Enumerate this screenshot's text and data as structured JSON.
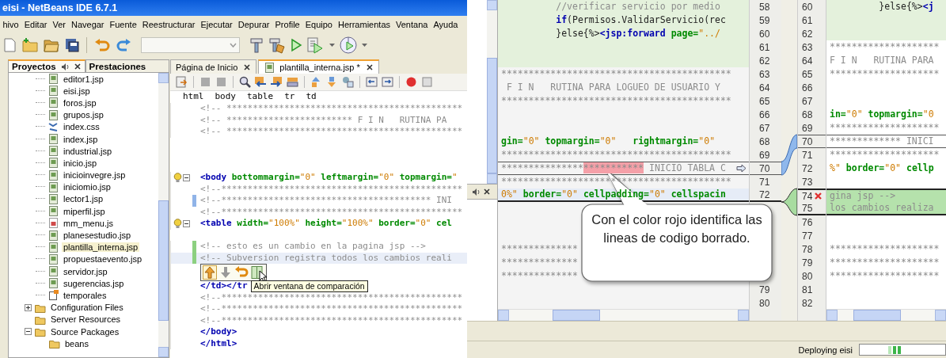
{
  "window": {
    "title": "eisi - NetBeans IDE 6.7.1"
  },
  "menu": [
    "hivo",
    "Editar",
    "Ver",
    "Navegar",
    "Fuente",
    "Reestructurar",
    "Ejecutar",
    "Depurar",
    "Profile",
    "Equipo",
    "Herramientas",
    "Ventana",
    "Ayuda"
  ],
  "panel": {
    "tabs": [
      {
        "label": "Proyectos",
        "selected": true
      },
      {
        "label": "Prestaciones",
        "selected": false
      }
    ],
    "tree": {
      "files": [
        {
          "label": "editor1.jsp",
          "kind": "jsp",
          "selected": false
        },
        {
          "label": "eisi.jsp",
          "kind": "jsp",
          "selected": false
        },
        {
          "label": "foros.jsp",
          "kind": "jsp",
          "selected": false
        },
        {
          "label": "grupos.jsp",
          "kind": "jsp",
          "selected": false
        },
        {
          "label": "index.css",
          "kind": "css",
          "selected": false
        },
        {
          "label": "index.jsp",
          "kind": "jsp",
          "selected": false
        },
        {
          "label": "industrial.jsp",
          "kind": "jsp",
          "selected": false
        },
        {
          "label": "inicio.jsp",
          "kind": "jsp",
          "selected": false
        },
        {
          "label": "inicioinvegre.jsp",
          "kind": "jsp",
          "selected": false
        },
        {
          "label": "iniciomio.jsp",
          "kind": "jsp",
          "selected": false
        },
        {
          "label": "lector1.jsp",
          "kind": "jsp",
          "selected": false
        },
        {
          "label": "miperfil.jsp",
          "kind": "jsp",
          "selected": false
        },
        {
          "label": "mm_menu.js",
          "kind": "js",
          "selected": false
        },
        {
          "label": "planesestudio.jsp",
          "kind": "jsp",
          "selected": false
        },
        {
          "label": "plantilla_interna.jsp",
          "kind": "jsp",
          "selected": true
        },
        {
          "label": "propuestaevento.jsp",
          "kind": "jsp",
          "selected": false
        },
        {
          "label": "servidor.jsp",
          "kind": "jsp",
          "selected": false
        },
        {
          "label": "sugerencias.jsp",
          "kind": "jsp",
          "selected": false
        },
        {
          "label": "temporales",
          "kind": "marked",
          "selected": false
        }
      ],
      "groups": [
        {
          "label": "Configuration Files",
          "expanded": false
        },
        {
          "label": "Server Resources"
        },
        {
          "label": "Source Packages",
          "expanded": true,
          "children": [
            {
              "label": "beans"
            }
          ]
        }
      ]
    }
  },
  "editor": {
    "tabs": [
      {
        "label": "Página de Inicio",
        "selected": false
      },
      {
        "label": "plantilla_interna.jsp *",
        "selected": true
      }
    ],
    "breadcrumb": [
      "html",
      "body",
      "table",
      "tr",
      "td"
    ],
    "lines": [
      {
        "kind": "code",
        "hint": false,
        "fold": false,
        "added_marker": false,
        "changed_marker": false,
        "current": false,
        "segs": [
          {
            "kind": "comment",
            "text": "<!-- *********************************************"
          }
        ]
      },
      {
        "kind": "code",
        "hint": false,
        "fold": false,
        "added_marker": false,
        "changed_marker": false,
        "current": false,
        "segs": [
          {
            "kind": "comment",
            "text": "<!-- ************************ F I N   RUTINA PA"
          }
        ]
      },
      {
        "kind": "code",
        "hint": false,
        "fold": false,
        "added_marker": false,
        "changed_marker": false,
        "current": false,
        "segs": [
          {
            "kind": "comment",
            "text": "<!-- *********************************************"
          }
        ]
      },
      {
        "kind": "blank"
      },
      {
        "kind": "blank"
      },
      {
        "kind": "blank"
      },
      {
        "kind": "code",
        "hint": true,
        "fold": true,
        "added_marker": false,
        "changed_marker": false,
        "current": false,
        "segs": [
          {
            "kind": "tag",
            "text": "<body"
          },
          {
            "kind": "attr",
            "text": " bottommargin="
          },
          {
            "kind": "value",
            "text": "\"0\""
          },
          {
            "kind": "attr",
            "text": " leftmargin="
          },
          {
            "kind": "value",
            "text": "\"0\""
          },
          {
            "kind": "attr",
            "text": " topmargin="
          },
          {
            "kind": "value",
            "text": "\""
          }
        ]
      },
      {
        "kind": "code",
        "hint": false,
        "fold": false,
        "added_marker": false,
        "changed_marker": false,
        "current": false,
        "segs": [
          {
            "kind": "comment",
            "text": "<!--**********************************************"
          }
        ]
      },
      {
        "kind": "code",
        "hint": false,
        "fold": false,
        "added_marker": false,
        "changed_marker": true,
        "current": false,
        "segs": [
          {
            "kind": "comment",
            "text": "<!--**************************************** INI"
          }
        ]
      },
      {
        "kind": "code",
        "hint": false,
        "fold": false,
        "added_marker": false,
        "changed_marker": false,
        "current": false,
        "segs": [
          {
            "kind": "comment",
            "text": "<!--**********************************************"
          }
        ]
      },
      {
        "kind": "code",
        "hint": true,
        "fold": true,
        "added_marker": false,
        "changed_marker": false,
        "current": false,
        "segs": [
          {
            "kind": "tag",
            "text": "<table"
          },
          {
            "kind": "attr",
            "text": " width="
          },
          {
            "kind": "value",
            "text": "\"100%\""
          },
          {
            "kind": "attr",
            "text": " height="
          },
          {
            "kind": "value",
            "text": "\"100%\""
          },
          {
            "kind": "attr",
            "text": " border="
          },
          {
            "kind": "value",
            "text": "\"0\""
          },
          {
            "kind": "attr",
            "text": " cel"
          }
        ]
      },
      {
        "kind": "blank"
      },
      {
        "kind": "code",
        "hint": false,
        "fold": false,
        "added_marker": true,
        "changed_marker": false,
        "current": false,
        "segs": [
          {
            "kind": "comment",
            "text": "<!-- esto es un cambio en la pagina jsp -->"
          }
        ]
      },
      {
        "kind": "code",
        "hint": false,
        "fold": false,
        "added_marker": true,
        "changed_marker": false,
        "current": true,
        "segs": [
          {
            "kind": "comment",
            "text": "<!-- Subversion registra todos los cambios reali"
          }
        ]
      },
      {
        "kind": "popup"
      },
      {
        "kind": "code",
        "hint": false,
        "fold": false,
        "added_marker": false,
        "changed_marker": false,
        "current": false,
        "segs": [
          {
            "kind": "tag",
            "text": "</td></tr"
          }
        ],
        "tooltip": "Abrir ventana de comparación"
      },
      {
        "kind": "code",
        "hint": false,
        "fold": false,
        "added_marker": false,
        "changed_marker": false,
        "current": false,
        "segs": [
          {
            "kind": "comment",
            "text": "<!--**********************************************"
          }
        ]
      },
      {
        "kind": "code",
        "hint": false,
        "fold": false,
        "added_marker": false,
        "changed_marker": false,
        "current": false,
        "segs": [
          {
            "kind": "comment",
            "text": "<!--**********************************************"
          }
        ]
      },
      {
        "kind": "code",
        "hint": false,
        "fold": false,
        "added_marker": false,
        "changed_marker": false,
        "current": false,
        "segs": [
          {
            "kind": "comment",
            "text": "<!--**********************************************"
          }
        ]
      },
      {
        "kind": "code",
        "hint": false,
        "fold": false,
        "added_marker": false,
        "changed_marker": false,
        "current": false,
        "segs": [
          {
            "kind": "tag",
            "text": "</body>"
          }
        ]
      },
      {
        "kind": "code",
        "hint": false,
        "fold": false,
        "added_marker": false,
        "changed_marker": false,
        "current": false,
        "segs": [
          {
            "kind": "tag",
            "text": "</html>"
          }
        ]
      }
    ]
  },
  "diff": {
    "left": [
      {
        "num": "58",
        "kind": "added",
        "segs": [
          {
            "kind": "comment",
            "text": "          //verificar servicio por medio"
          }
        ]
      },
      {
        "num": "59",
        "kind": "added",
        "segs": [
          {
            "kind": "keyword",
            "text": "          if"
          },
          {
            "kind": "plain",
            "text": "(Permisos.ValidarServicio(rec"
          }
        ]
      },
      {
        "num": "60",
        "kind": "added",
        "segs": [
          {
            "kind": "plain",
            "text": "          }else{%>"
          },
          {
            "kind": "jsptag",
            "text": "<jsp:forward"
          },
          {
            "kind": "attr",
            "text": " page="
          },
          {
            "kind": "value",
            "text": "\"../"
          }
        ]
      },
      {
        "num": "61",
        "kind": "added"
      },
      {
        "num": "62",
        "kind": "added"
      },
      {
        "num": "63",
        "kind": "plain",
        "segs": [
          {
            "kind": "comment",
            "text": "******************************************"
          }
        ]
      },
      {
        "num": "64",
        "kind": "plain",
        "segs": [
          {
            "kind": "comment",
            "text": " F I N   RUTINA PARA LOGUEO DE USUARIO Y"
          }
        ]
      },
      {
        "num": "65",
        "kind": "plain",
        "segs": [
          {
            "kind": "comment",
            "text": "******************************************"
          }
        ]
      },
      {
        "num": "66",
        "kind": "plain"
      },
      {
        "num": "67",
        "kind": "plain"
      },
      {
        "num": "68",
        "kind": "plain",
        "segs": [
          {
            "kind": "attr",
            "text": "gin="
          },
          {
            "kind": "value",
            "text": "\"0\""
          },
          {
            "kind": "attr",
            "text": " topmargin="
          },
          {
            "kind": "value",
            "text": "\"0\""
          },
          {
            "kind": "attr",
            "text": "   rightmargin="
          },
          {
            "kind": "value",
            "text": "\"0\""
          }
        ]
      },
      {
        "num": "69",
        "kind": "plain",
        "segs": [
          {
            "kind": "comment",
            "text": "******************************************"
          }
        ]
      },
      {
        "num": "70",
        "kind": "modified",
        "segs": [
          {
            "kind": "comment",
            "text": "***************"
          },
          {
            "kind": "removed",
            "text": "***********"
          },
          {
            "kind": "comment",
            "text": " INICIO TABLA C"
          }
        ]
      },
      {
        "num": "71",
        "kind": "plain",
        "segs": [
          {
            "kind": "comment",
            "text": "******************************************"
          }
        ]
      },
      {
        "num": "72",
        "kind": "insert_point",
        "segs": [
          {
            "kind": "value",
            "text": "0%\""
          },
          {
            "kind": "attr",
            "text": " border="
          },
          {
            "kind": "value",
            "text": "\"0\""
          },
          {
            "kind": "attr",
            "text": " cellpadding="
          },
          {
            "kind": "value",
            "text": "\"0\""
          },
          {
            "kind": "attr",
            "text": " cellspacin"
          }
        ]
      },
      {
        "kind": "plain"
      },
      {
        "kind": "plain"
      },
      {
        "kind": "plain"
      },
      {
        "kind": "plain",
        "segs": [
          {
            "kind": "comment",
            "text": "**************"
          }
        ]
      },
      {
        "kind": "plain",
        "segs": [
          {
            "kind": "comment",
            "text": "**************"
          }
        ]
      },
      {
        "kind": "plain",
        "segs": [
          {
            "kind": "comment",
            "text": "**************"
          }
        ]
      },
      {
        "num": "79",
        "kind": "plain"
      },
      {
        "num": "80",
        "kind": "plain"
      }
    ],
    "right": [
      {
        "num": "60",
        "kind": "added",
        "deleted_marker": false,
        "segs": [
          {
            "kind": "plain",
            "text": "         }else{%>"
          },
          {
            "kind": "jsptag",
            "text": "<j"
          }
        ]
      },
      {
        "num": "61",
        "kind": "added",
        "deleted_marker": false
      },
      {
        "num": "62",
        "kind": "added",
        "deleted_marker": false
      },
      {
        "num": "63",
        "kind": "plain",
        "deleted_marker": false,
        "segs": [
          {
            "kind": "comment",
            "text": "********************"
          }
        ]
      },
      {
        "num": "64",
        "kind": "plain",
        "deleted_marker": false,
        "segs": [
          {
            "kind": "comment",
            "text": "F I N   RUTINA PARA"
          }
        ]
      },
      {
        "num": "65",
        "kind": "plain",
        "deleted_marker": false,
        "segs": [
          {
            "kind": "comment",
            "text": "********************"
          }
        ]
      },
      {
        "num": "66",
        "kind": "plain",
        "deleted_marker": false
      },
      {
        "num": "67",
        "kind": "plain",
        "deleted_marker": false
      },
      {
        "num": "68",
        "kind": "plain",
        "deleted_marker": false,
        "segs": [
          {
            "kind": "attr",
            "text": "in="
          },
          {
            "kind": "value",
            "text": "\"0\""
          },
          {
            "kind": "attr",
            "text": " topmargin="
          },
          {
            "kind": "value",
            "text": "\"0"
          }
        ]
      },
      {
        "num": "69",
        "kind": "plain",
        "deleted_marker": false,
        "segs": [
          {
            "kind": "comment",
            "text": "********************"
          }
        ]
      },
      {
        "num": "70",
        "kind": "modified",
        "deleted_marker": false,
        "segs": [
          {
            "kind": "comment",
            "text": "************* INICI"
          }
        ]
      },
      {
        "num": "71",
        "kind": "plain",
        "deleted_marker": false,
        "segs": [
          {
            "kind": "comment",
            "text": "********************"
          }
        ]
      },
      {
        "num": "72",
        "kind": "plain",
        "deleted_marker": false,
        "segs": [
          {
            "kind": "value",
            "text": "%\""
          },
          {
            "kind": "attr",
            "text": " border="
          },
          {
            "kind": "value",
            "text": "\"0\""
          },
          {
            "kind": "attr",
            "text": " cellp"
          }
        ]
      },
      {
        "num": "73",
        "kind": "plain",
        "deleted_marker": false
      },
      {
        "num": "74",
        "kind": "added_current",
        "deleted_marker": true,
        "segs": [
          {
            "kind": "comment",
            "text": "gina jsp -->"
          }
        ]
      },
      {
        "num": "75",
        "kind": "added_current",
        "deleted_marker": false,
        "segs": [
          {
            "kind": "comment",
            "text": "los cambios realiza"
          }
        ]
      },
      {
        "num": "76",
        "kind": "plain",
        "deleted_marker": false
      },
      {
        "num": "77",
        "kind": "plain",
        "deleted_marker": false
      },
      {
        "num": "78",
        "kind": "plain",
        "deleted_marker": false,
        "segs": [
          {
            "kind": "comment",
            "text": "********************"
          }
        ]
      },
      {
        "num": "79",
        "kind": "plain",
        "deleted_marker": false,
        "segs": [
          {
            "kind": "comment",
            "text": "********************"
          }
        ]
      },
      {
        "num": "80",
        "kind": "plain",
        "deleted_marker": false,
        "segs": [
          {
            "kind": "comment",
            "text": "********************"
          }
        ]
      },
      {
        "num": "81",
        "kind": "plain",
        "deleted_marker": false
      },
      {
        "num": "82",
        "kind": "plain",
        "deleted_marker": false
      }
    ]
  },
  "callout": "Con el color rojo identifica las lineas de codigo borrado.",
  "status_bar": {
    "task": "Deploying eisi"
  }
}
